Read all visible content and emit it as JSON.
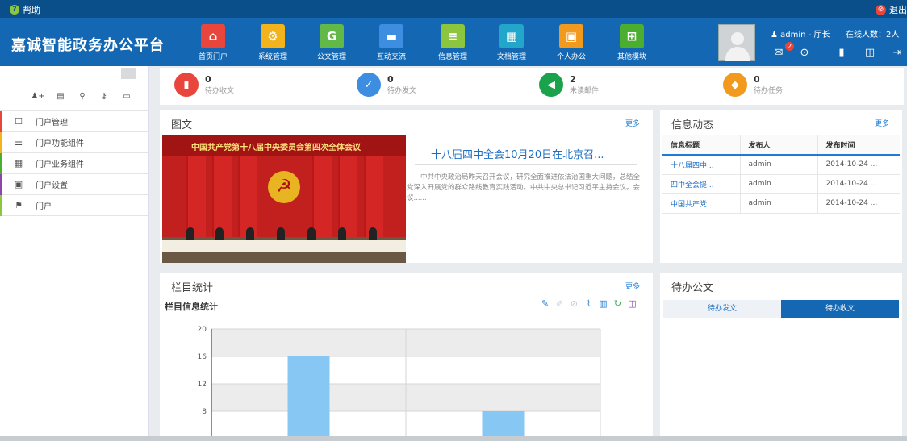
{
  "topbar": {
    "help_label": "帮助",
    "logout_label": "退出"
  },
  "header": {
    "brand": "嘉诚智能政务办公平台",
    "nav": [
      {
        "label": "首页门户",
        "icon": "home-icon",
        "color": "#e8453c",
        "glyph": "⌂"
      },
      {
        "label": "系统管理",
        "icon": "gears-icon",
        "color": "#f2b31d",
        "glyph": "⚙"
      },
      {
        "label": "公文管理",
        "icon": "document-icon",
        "color": "#63b947",
        "glyph": "G"
      },
      {
        "label": "互动交流",
        "icon": "chat-icon",
        "color": "#3d8ee0",
        "glyph": "▬"
      },
      {
        "label": "信息管理",
        "icon": "info-icon",
        "color": "#8cc63f",
        "glyph": "≡"
      },
      {
        "label": "文档管理",
        "icon": "files-icon",
        "color": "#22a6c9",
        "glyph": "▦"
      },
      {
        "label": "个人办公",
        "icon": "briefcase-icon",
        "color": "#f29a1d",
        "glyph": "▣"
      },
      {
        "label": "其他模块",
        "icon": "grid-icon",
        "color": "#4cae2f",
        "glyph": "⊞"
      }
    ],
    "user": "admin - 厅长",
    "online": "在线人数：2人",
    "mail_badge": "2"
  },
  "sidebar": {
    "menu": [
      {
        "label": "门户管理",
        "color": "#e8453c"
      },
      {
        "label": "门户功能组件",
        "color": "#f2b31d"
      },
      {
        "label": "门户业务组件",
        "color": "#4cae2f"
      },
      {
        "label": "门户设置",
        "color": "#8e44ad"
      },
      {
        "label": "门户",
        "color": "#8cc63f"
      }
    ]
  },
  "stats": [
    {
      "value": "0",
      "label": "待办收文",
      "color": "#e8453c"
    },
    {
      "value": "0",
      "label": "待办发文",
      "color": "#3d8ee0"
    },
    {
      "value": "2",
      "label": "未读邮件",
      "color": "#1aa34a"
    },
    {
      "value": "0",
      "label": "待办任务",
      "color": "#f29a1d"
    }
  ],
  "news": {
    "title": "图文",
    "more": "更多",
    "banner": "中国共产党第十八届中央委员会第四次全体会议",
    "headline": "十八届四中全会10月20日在北京召...",
    "body": "中共中央政治局昨天召开会议，研究全面推进依法治国重大问题，总结全党深入开展党的群众路线教育实践活动。中共中央总书记习近平主持会议。会议......"
  },
  "info": {
    "title": "信息动态",
    "more": "更多",
    "columns": [
      "信息标题",
      "发布人",
      "发布时间"
    ],
    "rows": [
      [
        "十八届四中...",
        "admin",
        "2014-10-24 ..."
      ],
      [
        "四中全会提...",
        "admin",
        "2014-10-24 ..."
      ],
      [
        "中国共产党...",
        "admin",
        "2014-10-24 ..."
      ]
    ]
  },
  "columns_panel": {
    "title": "栏目统计",
    "more": "更多",
    "chart_title": "栏目信息统计"
  },
  "chart_data": {
    "type": "bar",
    "title": "栏目信息统计",
    "categories": [
      "",
      ""
    ],
    "values": [
      16,
      8
    ],
    "yticks": [
      8,
      12,
      16,
      20
    ],
    "ylim": [
      4,
      20
    ],
    "color": "#86c7f3",
    "grid": true
  },
  "pending": {
    "title": "待办公文",
    "tabs": [
      "待办发文",
      "待办收文"
    ],
    "active": 1
  }
}
